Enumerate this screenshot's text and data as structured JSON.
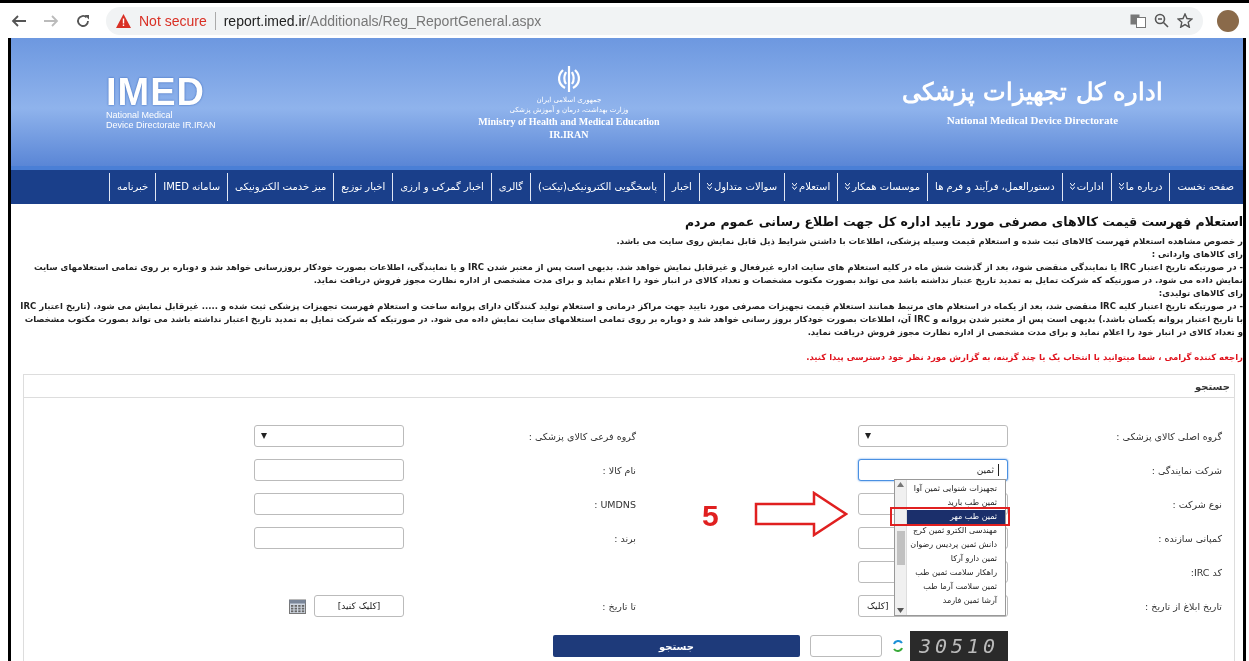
{
  "browser": {
    "not_secure": "Not secure",
    "url_host": "report.imed.ir",
    "url_path": "/Additionals/Reg_ReportGeneral.aspx"
  },
  "banner": {
    "logo_text": "IMED",
    "logo_subtitle_1": "National Medical",
    "logo_subtitle_2": "Device Directorate IR.IRAN",
    "emblem_line_1": "جمهوری اسلامی ایران",
    "emblem_line_2": "وزارت بهداشت، درمان و آموزش پزشکی",
    "ministry": "Ministry of Health and Medical Education",
    "country": "IR.IRAN",
    "directorate_fa": "اداره کل تجهیزات پزشکی",
    "directorate_en": "National Medical Device Directorate"
  },
  "nav": [
    {
      "label": "صفحه نخست",
      "has_menu": false
    },
    {
      "label": "درباره ما",
      "has_menu": true
    },
    {
      "label": "ادارات",
      "has_menu": true
    },
    {
      "label": "دستورالعمل، فرآیند و فرم ها",
      "has_menu": false
    },
    {
      "label": "موسسات همکار",
      "has_menu": true
    },
    {
      "label": "استعلام",
      "has_menu": true
    },
    {
      "label": "سوالات متداول",
      "has_menu": true
    },
    {
      "label": "اخبار",
      "has_menu": false
    },
    {
      "label": "پاسخگویی الکترونیکی(تیکت)",
      "has_menu": false
    },
    {
      "label": "گالری",
      "has_menu": false
    },
    {
      "label": "اخبار گمرکی و ارزی",
      "has_menu": false
    },
    {
      "label": "اخبار توزیع",
      "has_menu": false
    },
    {
      "label": "میز خدمت الکترونیکی",
      "has_menu": false
    },
    {
      "label": "سامانه IMED",
      "has_menu": false
    },
    {
      "label": "خبرنامه",
      "has_menu": false
    }
  ],
  "intro": {
    "title": "استعلام فهرست قیمت کالاهای مصرفی مورد تایید اداره کل جهت اطلاع رسانی عموم مردم",
    "paragraphs": [
      {
        "kind": "text",
        "text": "ر خصوص مشاهده استعلام فهرست کالاهای ثبت شده و استعلام قیمت وسیله پزشکی، اطلاعات با داشتن شرایط ذیل قابل نمایش روی سایت می باشد."
      },
      {
        "kind": "text",
        "text": "رای کالاهای وارداتی :"
      },
      {
        "kind": "text",
        "text": "- در صورتیکه تاریخ اعتبار IRC یا نمایندگی منقضی شود، بعد از گذشت شش ماه در کلیه استعلام های سایت اداره غیرفعال و غیرقابل نمایش خواهد شد. بدیهی است پس از معتبر شدن IRC و یا نمایندگی، اطلاعات بصورت خودکار بروزرسانی خواهد شد و دوباره بر روی تمامی استعلامهای سایت نمایش داده می شود. در صورتیکه که شرکت تمایل به تمدید تاریخ عتبار نداشته باشد می تواند بصورت مکتوب مشخصات و تعداد کالای در انبار خود را اعلام نماید و برای مدت مشخصی از اداره نظارت مجوز فروش دریافت نماید."
      },
      {
        "kind": "text",
        "text": "رای کالاهای تولیدی:"
      },
      {
        "kind": "text",
        "text": "- در صورتیکه تاریخ اعتبار کلیه IRC منقضی شد، بعد از یکماه در استعلام های مرتبط همانند استعلام قیمت تجهیزات مصرفی مورد تایید جهت مراکز درمانی و استعلام تولید کنندگان دارای پروانه ساخت و استعلام فهرست تجهیزات پزشکی ثبت شده و ..... غیرقابل نمایش می شود. (تاریخ اعتبار IRC با تاریخ اعتبار پروانه یکسان باشد.) بدیهی است پس از معتبر شدن پروانه و IRC آن، اطلاعات بصورت خودکار بروز رسانی خواهد شد و دوباره بر روی تمامی استعلامهای سایت نمایش داده می شود. در صورتیکه که شرکت تمایل به تمدید تاریخ اعتبار نداشته باشد می تواند بصورت مکتوب مشخصات و تعداد کالای در انبار خود را اعلام نماید و برای مدت مشخصی از اداره نظارت مجوز فروش دریافت نماید."
      },
      {
        "kind": "notice",
        "text": "راجعه کننده گرامی ، شما میتوانید با انتخاب یک یا چند گزینه، به گزارش مورد نظر خود دسترسی پیدا کنید."
      }
    ]
  },
  "search": {
    "legend": "جستجو",
    "rows": [
      [
        {
          "label": "گروه اصلی کالای پزشکی :",
          "kind": "select"
        },
        {
          "label": "گروه فرعی کالای پزشکی :",
          "kind": "select"
        }
      ],
      [
        {
          "label": "شرکت نمایندگی :",
          "kind": "autocomplete",
          "value": "ثمین",
          "focused": true
        },
        {
          "label": "نام کالا :",
          "kind": "input"
        }
      ],
      [
        {
          "label": "نوع شرکت :",
          "kind": "input"
        },
        {
          "label": "UMDNS :",
          "kind": "input"
        }
      ],
      [
        {
          "label": "کمپانی سازنده :",
          "kind": "input"
        },
        {
          "label": "برند :",
          "kind": "input"
        }
      ],
      [
        {
          "label": "کد IRC:",
          "kind": "input"
        }
      ],
      [
        {
          "label": "تاریخ ابلاغ از تاریخ :",
          "kind": "date",
          "value": "[کلیک"
        },
        {
          "label": "تا تاریخ :",
          "kind": "date",
          "value": "[کلیک کنید]"
        }
      ]
    ],
    "suggestions": [
      {
        "label": "تجهیزات شنوایی ثمین آوا",
        "selected": false
      },
      {
        "label": "ثمین طب بارید",
        "selected": false
      },
      {
        "label": "ثمین طب مهر",
        "selected": true
      },
      {
        "label": "مهندسی الکترو ثمین کرج",
        "selected": false
      },
      {
        "label": "دانش ثمین پردیس رضوان",
        "selected": false
      },
      {
        "label": "ثمین دارو آرکا",
        "selected": false
      },
      {
        "label": "راهکار سلامت ثمین طب",
        "selected": false
      },
      {
        "label": "ثمین سلامت آرما طب",
        "selected": false
      },
      {
        "label": "آرشا ثمین فارمد",
        "selected": false
      }
    ],
    "annotation": "5",
    "captcha_code": "30510",
    "submit": "جستجو"
  }
}
